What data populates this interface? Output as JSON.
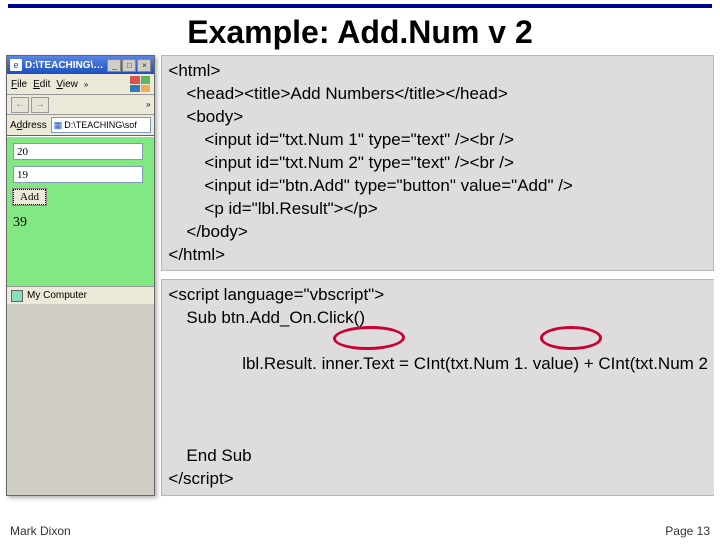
{
  "slide": {
    "title": "Example: Add.Num v 2"
  },
  "browser": {
    "titlebar_path": "D:\\TEACHING\\…",
    "menus": {
      "file": "File",
      "edit": "Edit",
      "view": "View",
      "more": "»"
    },
    "address_label": "Address",
    "address_value": "D:\\TEACHING\\sof",
    "toolbar_more": "»",
    "input1_value": "20",
    "input2_value": "19",
    "add_btn_label": "Add",
    "result_text": "39",
    "status_text": "My Computer",
    "min": "_",
    "max": "□",
    "close": "×",
    "nav_back": "←",
    "nav_fwd": "→"
  },
  "code1": {
    "l1": "<html>",
    "l2": "<head><title>Add Numbers</title></head>",
    "l3": "<body>",
    "l4": "<input id=\"txt.Num 1\" type=\"text\" /><br />",
    "l5": "<input id=\"txt.Num 2\" type=\"text\" /><br />",
    "l6": "<input id=\"btn.Add\" type=\"button\" value=\"Add\" />",
    "l7": "<p id=\"lbl.Result\"></p>",
    "l8": "</body>",
    "l9": "</html>"
  },
  "code2": {
    "l1": "<script language=\"vbscript\">",
    "l2": "Sub btn.Add_On.Click()",
    "l3": "lbl.Result. inner.Text = CInt(txt.Num 1. value) + CInt(txt.Num 2",
    "l4": "End Sub",
    "l5": "</script>"
  },
  "footer": {
    "author": "Mark Dixon",
    "page": "Page 13"
  }
}
